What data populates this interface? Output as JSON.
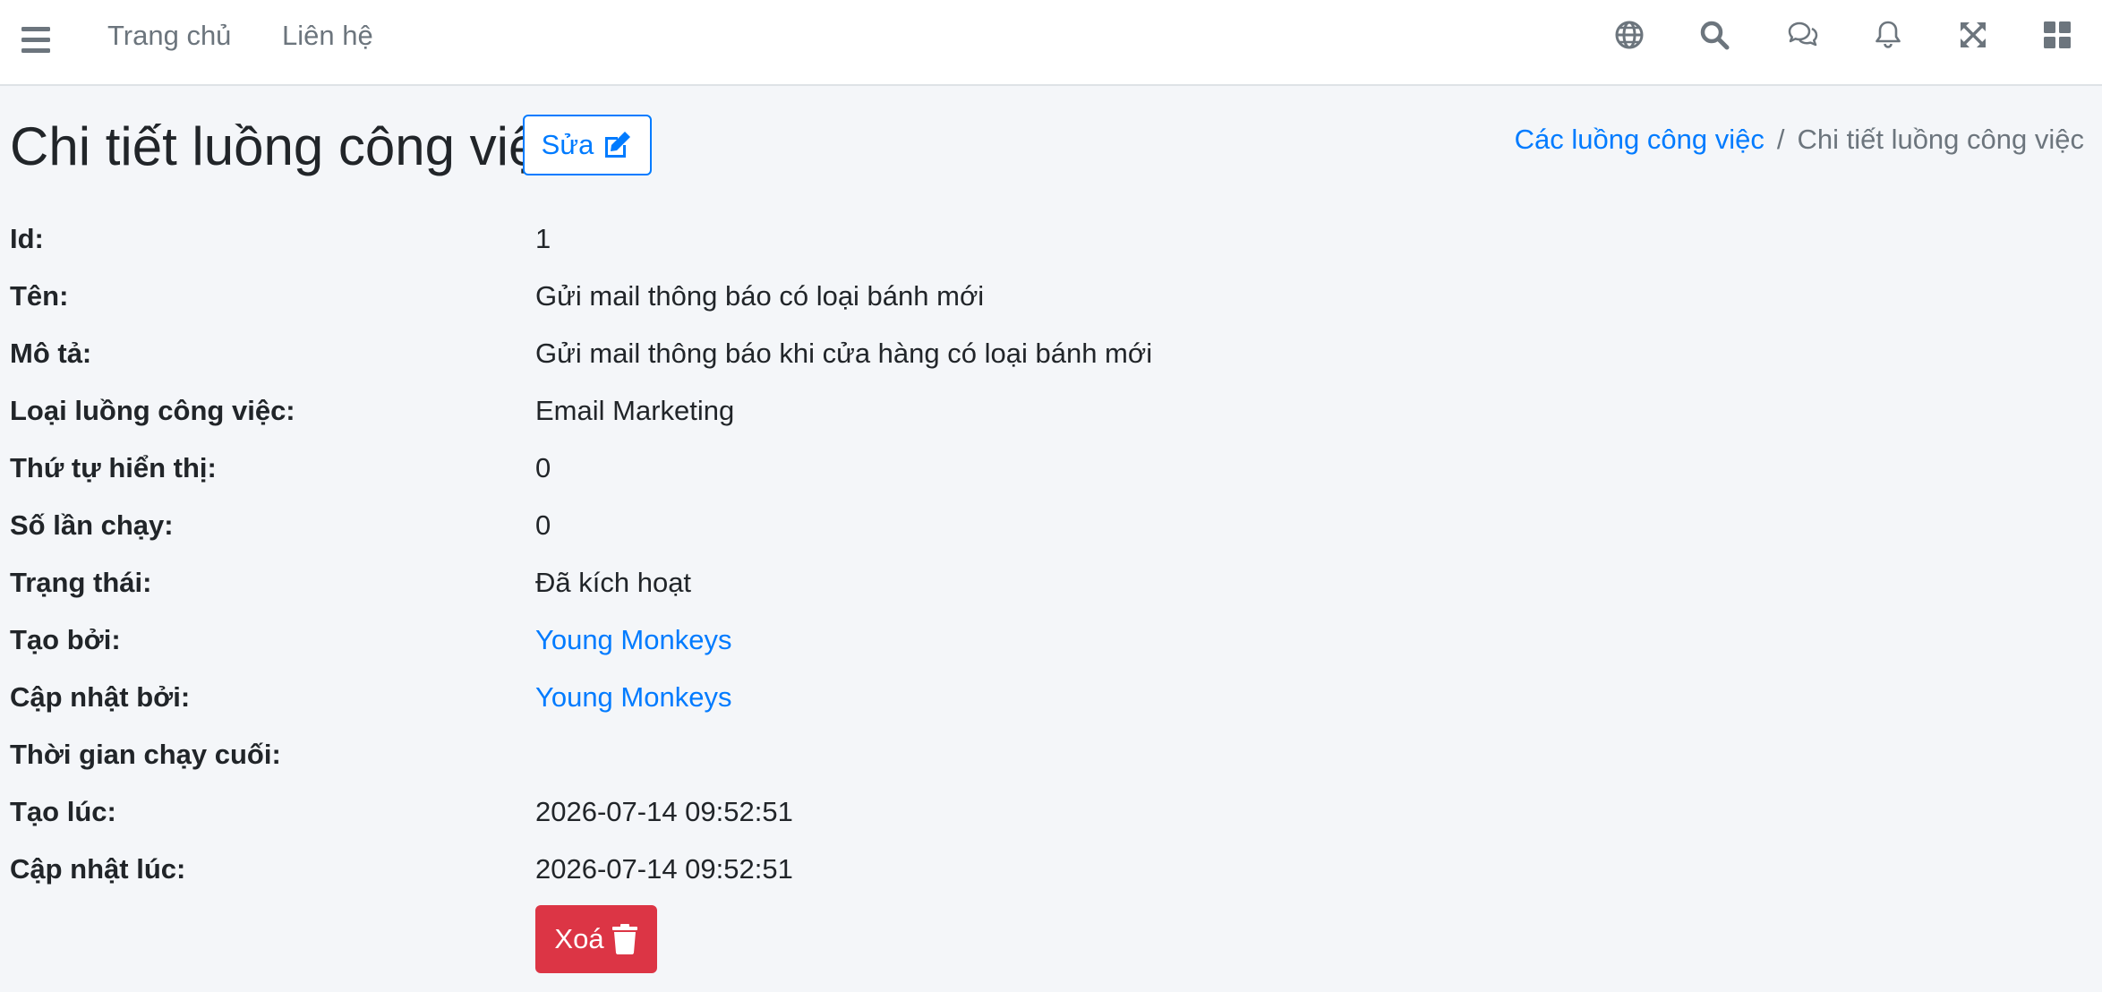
{
  "navbar": {
    "links": [
      "Trang chủ",
      "Liên hệ"
    ],
    "icons": [
      "language-icon",
      "search-icon",
      "messages-icon",
      "notifications-icon",
      "fullscreen-icon",
      "apps-grid-icon"
    ]
  },
  "header": {
    "title": "Chi tiết luồng công việc",
    "edit_label": "Sửa"
  },
  "breadcrumb": {
    "parent": "Các luồng công việc",
    "separator": "/",
    "current": "Chi tiết luồng công việc"
  },
  "details": [
    {
      "label": "Id:",
      "value": "1"
    },
    {
      "label": "Tên:",
      "value": "Gửi mail thông báo có loại bánh mới"
    },
    {
      "label": "Mô tả:",
      "value": "Gửi mail thông báo khi cửa hàng có loại bánh mới"
    },
    {
      "label": "Loại luồng công việc:",
      "value": "Email Marketing"
    },
    {
      "label": "Thứ tự hiển thị:",
      "value": "0"
    },
    {
      "label": "Số lần chạy:",
      "value": "0"
    },
    {
      "label": "Trạng thái:",
      "value": "Đã kích hoạt"
    },
    {
      "label": "Tạo bởi:",
      "value": "Young Monkeys"
    },
    {
      "label": "Cập nhật bởi:",
      "value": "Young Monkeys"
    },
    {
      "label": "Thời gian chạy cuối:",
      "value": ""
    },
    {
      "label": "Tạo lúc:",
      "value": "2026-07-14 09:52:51"
    },
    {
      "label": "Cập nhật lúc:",
      "value": "2026-07-14 09:52:51"
    }
  ],
  "actions": {
    "delete_label": "Xoá"
  },
  "colors": {
    "primary": "#007bff",
    "danger": "#dc3545",
    "background": "#f4f6f9"
  }
}
